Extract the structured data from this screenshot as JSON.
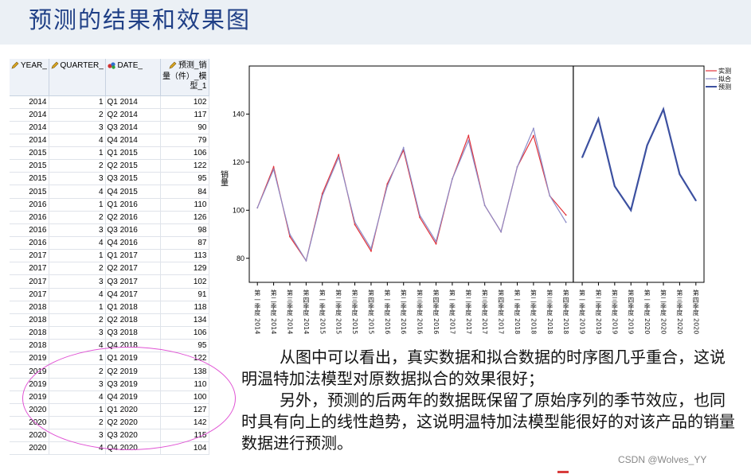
{
  "page": {
    "title": "预测的结果和效果图",
    "watermark": "CSDN @Wolves_YY"
  },
  "table": {
    "headers": [
      {
        "label": "YEAR_",
        "icon": "pencil-icon"
      },
      {
        "label": "QUARTER_",
        "icon": "pencil-icon"
      },
      {
        "label": "DATE_",
        "icon": "nominal-icon"
      },
      {
        "label": "预测_销量（件）_模型_1",
        "icon": "pencil-icon"
      }
    ],
    "rows": [
      [
        "2014",
        "1",
        "Q1 2014",
        "102"
      ],
      [
        "2014",
        "2",
        "Q2 2014",
        "117"
      ],
      [
        "2014",
        "3",
        "Q3 2014",
        "90"
      ],
      [
        "2014",
        "4",
        "Q4 2014",
        "79"
      ],
      [
        "2015",
        "1",
        "Q1 2015",
        "106"
      ],
      [
        "2015",
        "2",
        "Q2 2015",
        "122"
      ],
      [
        "2015",
        "3",
        "Q3 2015",
        "95"
      ],
      [
        "2015",
        "4",
        "Q4 2015",
        "84"
      ],
      [
        "2016",
        "1",
        "Q1 2016",
        "110"
      ],
      [
        "2016",
        "2",
        "Q2 2016",
        "126"
      ],
      [
        "2016",
        "3",
        "Q3 2016",
        "98"
      ],
      [
        "2016",
        "4",
        "Q4 2016",
        "87"
      ],
      [
        "2017",
        "1",
        "Q1 2017",
        "113"
      ],
      [
        "2017",
        "2",
        "Q2 2017",
        "129"
      ],
      [
        "2017",
        "3",
        "Q3 2017",
        "102"
      ],
      [
        "2017",
        "4",
        "Q4 2017",
        "91"
      ],
      [
        "2018",
        "1",
        "Q1 2018",
        "118"
      ],
      [
        "2018",
        "2",
        "Q2 2018",
        "134"
      ],
      [
        "2018",
        "3",
        "Q3 2018",
        "106"
      ],
      [
        "2018",
        "4",
        "Q4 2018",
        "95"
      ],
      [
        "2019",
        "1",
        "Q1 2019",
        "122"
      ],
      [
        "2019",
        "2",
        "Q2 2019",
        "138"
      ],
      [
        "2019",
        "3",
        "Q3 2019",
        "110"
      ],
      [
        "2019",
        "4",
        "Q4 2019",
        "100"
      ],
      [
        "2020",
        "1",
        "Q1 2020",
        "127"
      ],
      [
        "2020",
        "2",
        "Q2 2020",
        "142"
      ],
      [
        "2020",
        "3",
        "Q3 2020",
        "115"
      ],
      [
        "2020",
        "4",
        "Q4 2020",
        "104"
      ]
    ]
  },
  "description": {
    "para1": "从图中可以看出，真实数据和拟合数据的时序图几乎重合，这说明温特加法模型对原数据拟合的效果很好；",
    "para2": "另外，预测的后两年的数据既保留了原始序列的季节效应，也同时具有向上的线性趋势，这说明温特加法模型能很好的对该产品的销量数据进行预测。"
  },
  "chart_data": {
    "type": "line",
    "ylabel": "销量",
    "ylim": [
      70,
      160
    ],
    "yticks": [
      80,
      100,
      120,
      140
    ],
    "categories": [
      "第一季度 2014",
      "第二季度 2014",
      "第三季度 2014",
      "第四季度 2014",
      "第一季度 2015",
      "第二季度 2015",
      "第三季度 2015",
      "第四季度 2015",
      "第一季度 2016",
      "第二季度 2016",
      "第三季度 2016",
      "第四季度 2016",
      "第一季度 2017",
      "第二季度 2017",
      "第三季度 2017",
      "第四季度 2017",
      "第一季度 2018",
      "第二季度 2018",
      "第三季度 2018",
      "第四季度 2018",
      "第一季度 2019",
      "第二季度 2019",
      "第三季度 2019",
      "第四季度 2019",
      "第一季度 2020",
      "第二季度 2020",
      "第三季度 2020",
      "第四季度 2020"
    ],
    "tick_quarters": [
      "一季度",
      "二季度",
      "三季度",
      "四季度",
      "一季度",
      "二季度",
      "三季度",
      "四季度",
      "一季度",
      "二季度",
      "三季度",
      "四季度",
      "一季度",
      "二季度",
      "三季度",
      "四季度",
      "一季度",
      "二季度",
      "三季度",
      "四季度",
      "一季度",
      "二季度",
      "三季度",
      "四季度",
      "一季度",
      "二季度",
      "三季度",
      "四季度"
    ],
    "tick_prefix": "第",
    "tick_years": [
      "2014",
      "2014",
      "2014",
      "2014",
      "2015",
      "2015",
      "2015",
      "2015",
      "2016",
      "2016",
      "2016",
      "2016",
      "2017",
      "2017",
      "2017",
      "2017",
      "2018",
      "2018",
      "2018",
      "2018",
      "2019",
      "2019",
      "2019",
      "2019",
      "2020",
      "2020",
      "2020",
      "2020"
    ],
    "forecast_start_index": 20,
    "series": [
      {
        "name": "实测",
        "color": "#e2323a",
        "values": [
          101,
          118,
          89,
          79,
          107,
          123,
          94,
          83,
          111,
          125,
          97,
          86,
          113,
          131,
          102,
          91,
          118,
          131,
          106,
          98,
          null,
          null,
          null,
          null,
          null,
          null,
          null,
          null
        ]
      },
      {
        "name": "拟合",
        "color": "#8c8cc8",
        "values": [
          101,
          117,
          90,
          79,
          106,
          122,
          95,
          84,
          110,
          126,
          98,
          87,
          113,
          129,
          102,
          91,
          118,
          134,
          106,
          95,
          null,
          null,
          null,
          null,
          null,
          null,
          null,
          null
        ]
      },
      {
        "name": "预测",
        "color": "#3c50a0",
        "values": [
          null,
          null,
          null,
          null,
          null,
          null,
          null,
          null,
          null,
          null,
          null,
          null,
          null,
          null,
          null,
          null,
          null,
          null,
          null,
          null,
          122,
          138,
          110,
          100,
          127,
          142,
          115,
          104
        ]
      }
    ],
    "legend": "top-right",
    "grid": false
  }
}
